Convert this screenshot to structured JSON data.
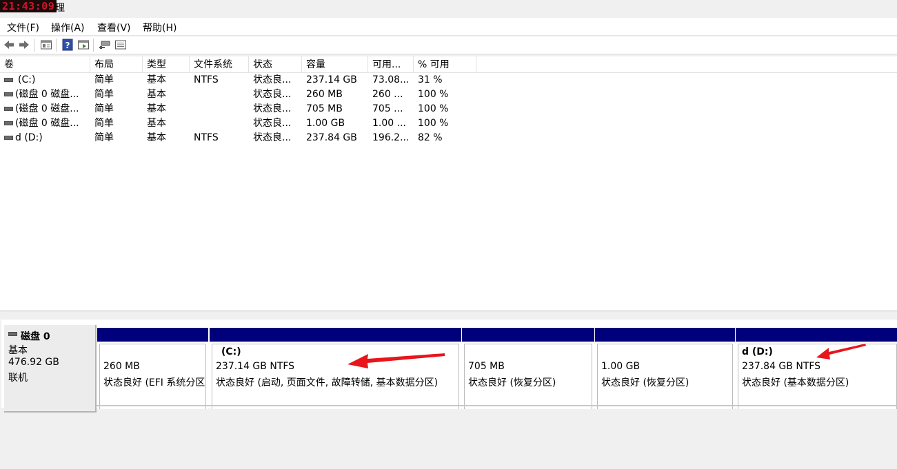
{
  "titlebar": {
    "clock": "21:43:09",
    "title_tail": "理"
  },
  "menu": [
    {
      "label": "文件(F)"
    },
    {
      "label": "操作(A)"
    },
    {
      "label": "查看(V)"
    },
    {
      "label": "帮助(H)"
    }
  ],
  "toolbar": {
    "icons": [
      "back-icon",
      "forward-icon",
      "properties-icon",
      "help-icon",
      "console-tree-icon",
      "connect-icon",
      "disk-list-icon"
    ]
  },
  "volume_table": {
    "columns": [
      "卷",
      "布局",
      "类型",
      "文件系统",
      "状态",
      "容量",
      "可用...",
      "% 可用"
    ],
    "rows": [
      [
        "(C:)",
        "简单",
        "基本",
        "NTFS",
        "状态良...",
        "237.14 GB",
        "73.08...",
        "31 %"
      ],
      [
        "(磁盘 0 磁盘...",
        "简单",
        "基本",
        "",
        "状态良...",
        "260 MB",
        "260 ...",
        "100 %"
      ],
      [
        "(磁盘 0 磁盘...",
        "简单",
        "基本",
        "",
        "状态良...",
        "705 MB",
        "705 ...",
        "100 %"
      ],
      [
        "(磁盘 0 磁盘...",
        "简单",
        "基本",
        "",
        "状态良...",
        "1.00 GB",
        "1.00 ...",
        "100 %"
      ],
      [
        "d (D:)",
        "简单",
        "基本",
        "NTFS",
        "状态良...",
        "237.84 GB",
        "196.2...",
        "82 %"
      ]
    ]
  },
  "disk": {
    "name": "磁盘 0",
    "type": "基本",
    "size": "476.92 GB",
    "status": "联机"
  },
  "partitions": [
    {
      "label": "",
      "size": "260 MB",
      "status": "状态良好 (EFI 系统分区)"
    },
    {
      "label": "(C:)",
      "size": "237.14 GB NTFS",
      "status": "状态良好 (启动, 页面文件, 故障转储, 基本数据分区)"
    },
    {
      "label": "",
      "size": "705 MB",
      "status": "状态良好 (恢复分区)"
    },
    {
      "label": "",
      "size": "1.00 GB",
      "status": "状态良好 (恢复分区)"
    },
    {
      "label": "d  (D:)",
      "size": "237.84 GB NTFS",
      "status": "状态良好 (基本数据分区)"
    }
  ],
  "colors": {
    "partition_bar": "#00007b",
    "annotation_arrow": "#e8151b",
    "clock_text": "#d4142a"
  }
}
